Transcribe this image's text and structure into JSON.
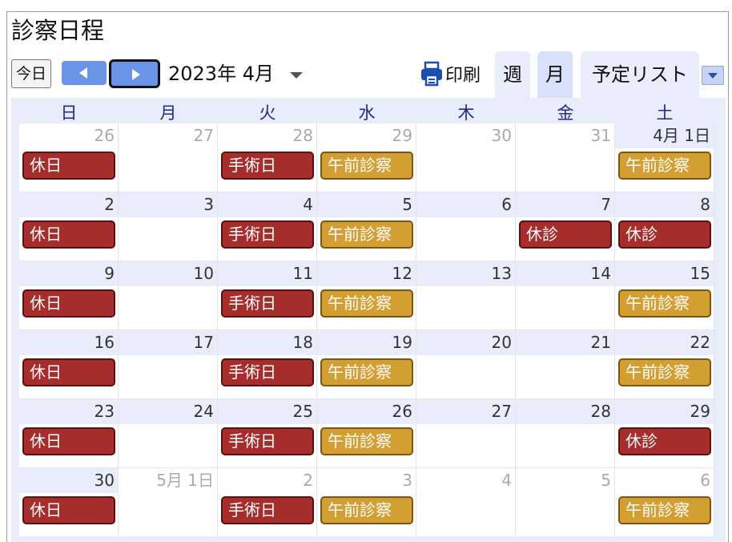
{
  "app": {
    "title": "診察日程"
  },
  "toolbar": {
    "today_label": "今日",
    "month_label": "2023年 4月",
    "print_label": "印刷",
    "view_week": "週",
    "view_month": "月",
    "view_list": "予定リスト",
    "active_view": "月"
  },
  "calendar": {
    "weekdays": [
      "日",
      "月",
      "火",
      "水",
      "木",
      "金",
      "土"
    ],
    "weeks": [
      [
        {
          "d": "26",
          "cur": false,
          "ev": {
            "t": "休日",
            "c": "red"
          }
        },
        {
          "d": "27",
          "cur": false
        },
        {
          "d": "28",
          "cur": false,
          "ev": {
            "t": "手術日",
            "c": "red"
          }
        },
        {
          "d": "29",
          "cur": false,
          "ev": {
            "t": "午前診察",
            "c": "gold"
          }
        },
        {
          "d": "30",
          "cur": false
        },
        {
          "d": "31",
          "cur": false
        },
        {
          "d": "4月 1日",
          "cur": true,
          "ev": {
            "t": "午前診察",
            "c": "gold"
          }
        }
      ],
      [
        {
          "d": "2",
          "cur": true,
          "ev": {
            "t": "休日",
            "c": "red"
          }
        },
        {
          "d": "3",
          "cur": true
        },
        {
          "d": "4",
          "cur": true,
          "ev": {
            "t": "手術日",
            "c": "red"
          }
        },
        {
          "d": "5",
          "cur": true,
          "ev": {
            "t": "午前診察",
            "c": "gold"
          }
        },
        {
          "d": "6",
          "cur": true
        },
        {
          "d": "7",
          "cur": true,
          "ev": {
            "t": "休診",
            "c": "red"
          }
        },
        {
          "d": "8",
          "cur": true,
          "ev": {
            "t": "休診",
            "c": "red"
          }
        }
      ],
      [
        {
          "d": "9",
          "cur": true,
          "ev": {
            "t": "休日",
            "c": "red"
          }
        },
        {
          "d": "10",
          "cur": true
        },
        {
          "d": "11",
          "cur": true,
          "ev": {
            "t": "手術日",
            "c": "red"
          }
        },
        {
          "d": "12",
          "cur": true,
          "ev": {
            "t": "午前診察",
            "c": "gold"
          }
        },
        {
          "d": "13",
          "cur": true
        },
        {
          "d": "14",
          "cur": true
        },
        {
          "d": "15",
          "cur": true,
          "ev": {
            "t": "午前診察",
            "c": "gold"
          }
        }
      ],
      [
        {
          "d": "16",
          "cur": true,
          "ev": {
            "t": "休日",
            "c": "red"
          }
        },
        {
          "d": "17",
          "cur": true
        },
        {
          "d": "18",
          "cur": true,
          "ev": {
            "t": "手術日",
            "c": "red"
          }
        },
        {
          "d": "19",
          "cur": true,
          "ev": {
            "t": "午前診察",
            "c": "gold"
          }
        },
        {
          "d": "20",
          "cur": true
        },
        {
          "d": "21",
          "cur": true
        },
        {
          "d": "22",
          "cur": true,
          "ev": {
            "t": "午前診察",
            "c": "gold"
          }
        }
      ],
      [
        {
          "d": "23",
          "cur": true,
          "ev": {
            "t": "休日",
            "c": "red"
          }
        },
        {
          "d": "24",
          "cur": true
        },
        {
          "d": "25",
          "cur": true,
          "ev": {
            "t": "手術日",
            "c": "red"
          }
        },
        {
          "d": "26",
          "cur": true,
          "ev": {
            "t": "午前診察",
            "c": "gold"
          }
        },
        {
          "d": "27",
          "cur": true
        },
        {
          "d": "28",
          "cur": true
        },
        {
          "d": "29",
          "cur": true,
          "ev": {
            "t": "休診",
            "c": "red"
          }
        }
      ],
      [
        {
          "d": "30",
          "cur": true,
          "ev": {
            "t": "休日",
            "c": "red"
          }
        },
        {
          "d": "5月 1日",
          "cur": false
        },
        {
          "d": "2",
          "cur": false,
          "ev": {
            "t": "手術日",
            "c": "red"
          }
        },
        {
          "d": "3",
          "cur": false,
          "ev": {
            "t": "午前診察",
            "c": "gold"
          }
        },
        {
          "d": "4",
          "cur": false
        },
        {
          "d": "5",
          "cur": false
        },
        {
          "d": "6",
          "cur": false,
          "ev": {
            "t": "午前診察",
            "c": "gold"
          }
        }
      ]
    ]
  },
  "colors": {
    "holiday_red": "#a52e2c",
    "morning_gold": "#d39f32",
    "nav_blue": "#6b93e8",
    "header_tint": "#e8ecfb"
  }
}
